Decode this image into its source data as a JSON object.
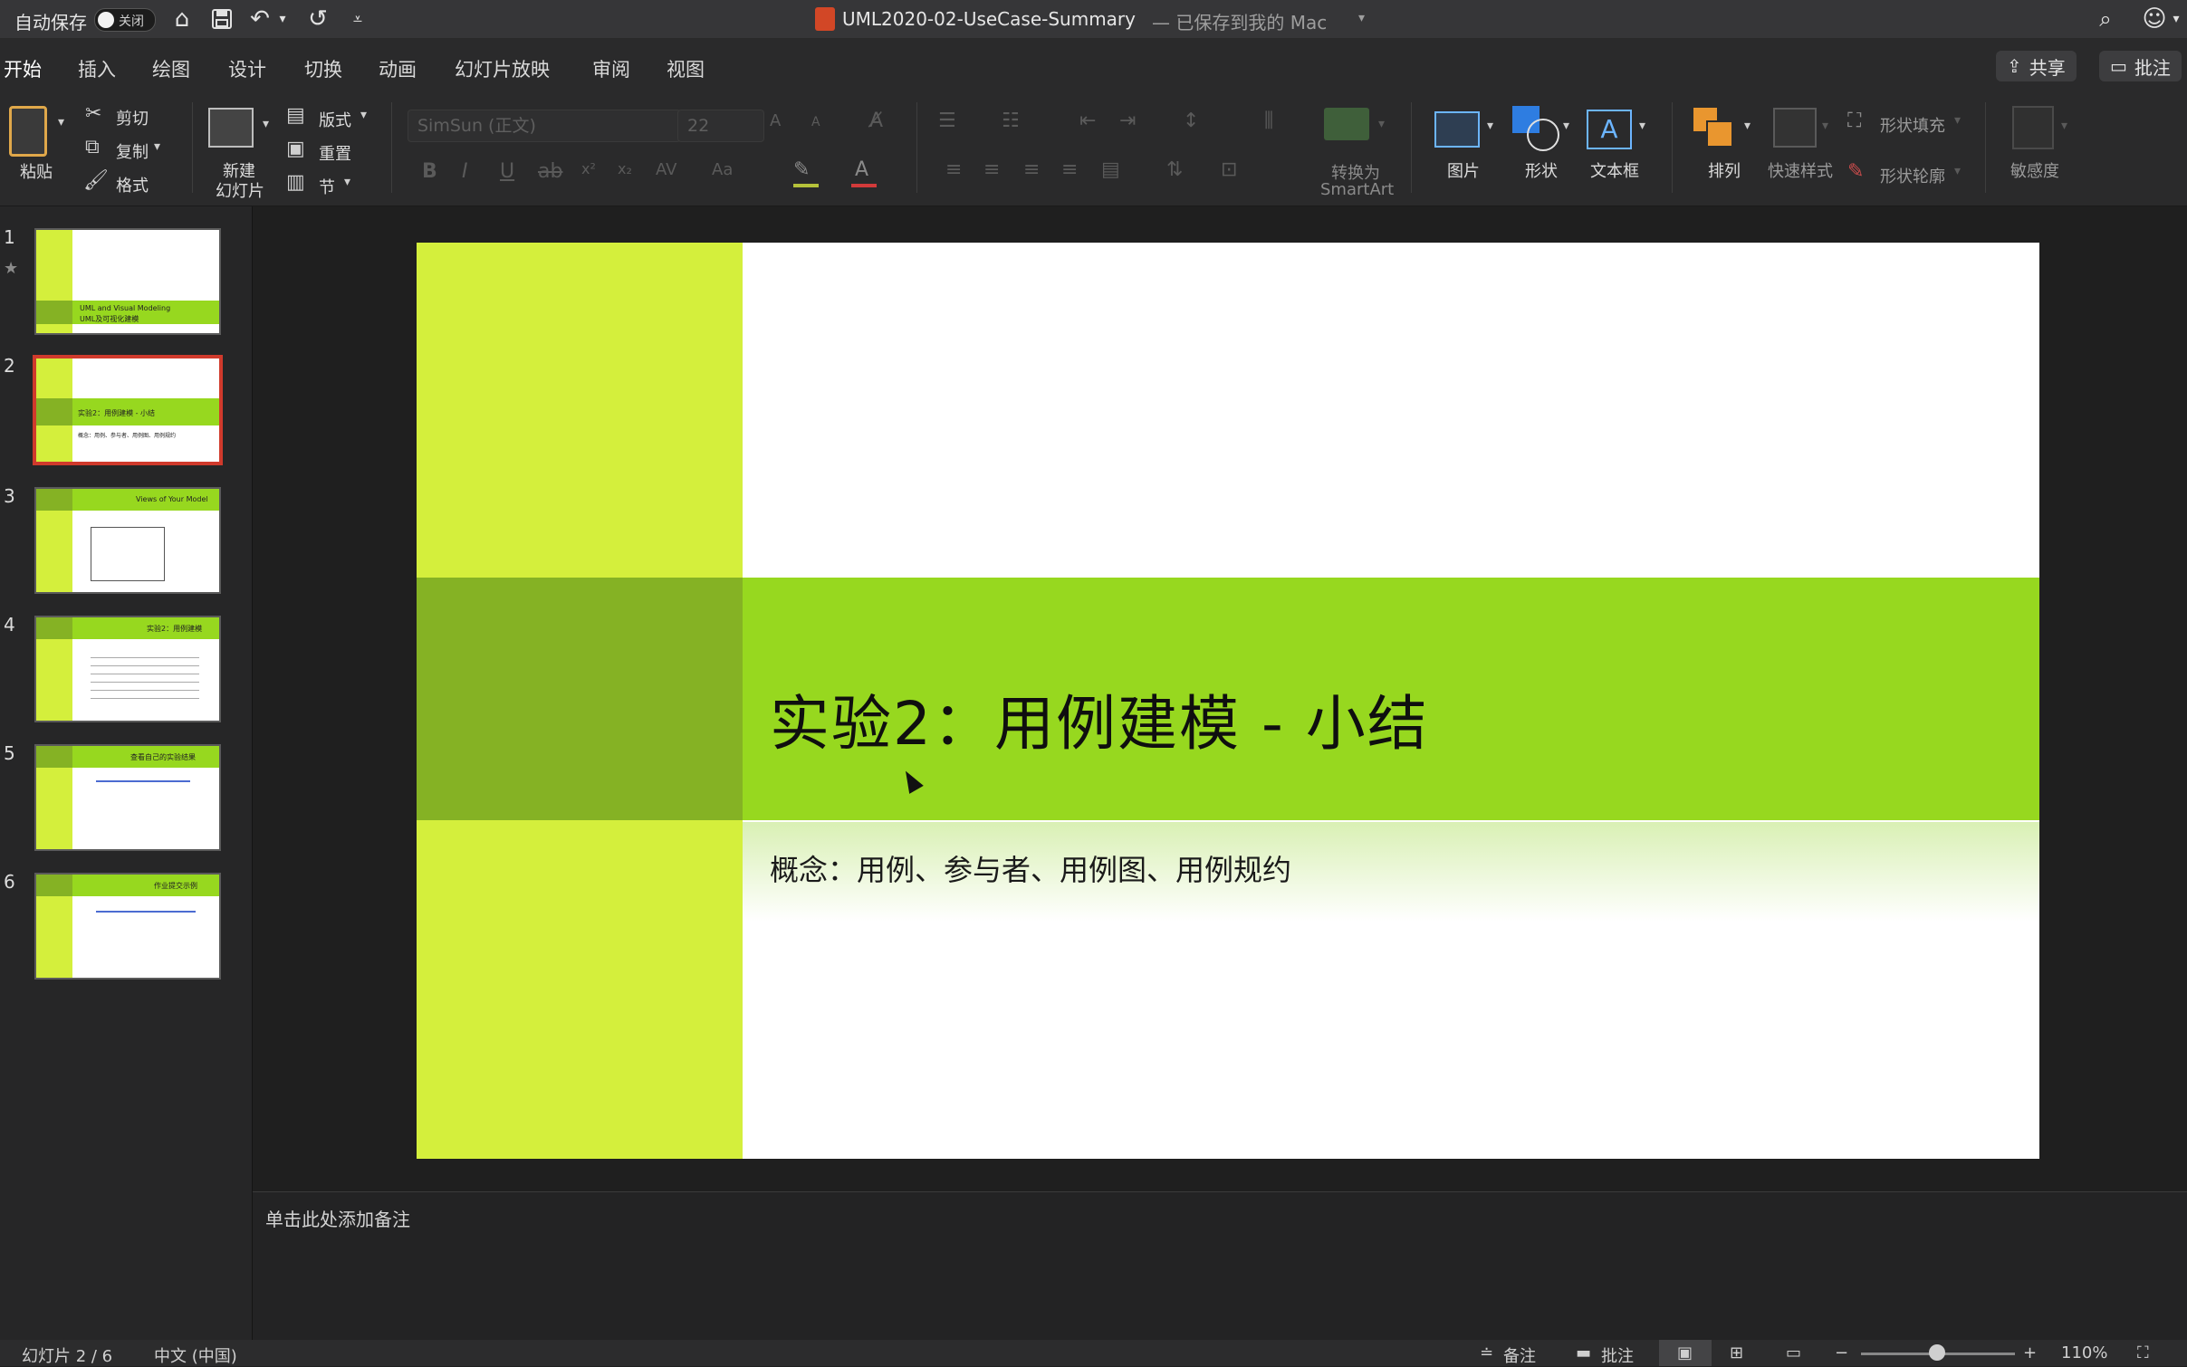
{
  "titlebar": {
    "autosave_label": "自动保存",
    "autosave_state": "关闭",
    "doc_title": "UML2020-02-UseCase-Summary",
    "save_status": "— 已保存到我的 Mac"
  },
  "tabs": [
    "开始",
    "插入",
    "绘图",
    "设计",
    "切换",
    "动画",
    "幻灯片放映",
    "审阅",
    "视图"
  ],
  "share_label": "共享",
  "comments_label": "批注",
  "ribbon": {
    "paste": "粘贴",
    "cut": "剪切",
    "copy": "复制",
    "format": "格式",
    "new_slide_line1": "新建",
    "new_slide_line2": "幻灯片",
    "layout": "版式",
    "reset": "重置",
    "section": "节",
    "font_name": "SimSun (正文)",
    "font_size": "22",
    "convert_line1": "转换为",
    "convert_line2": "SmartArt",
    "picture": "图片",
    "shape": "形状",
    "textbox": "文本框",
    "arrange": "排列",
    "quick_styles": "快速样式",
    "shape_fill": "形状填充",
    "shape_outline": "形状轮廓",
    "sensitivity": "敏感度"
  },
  "slides": [
    {
      "num": "1",
      "starred": true,
      "line1": "UML and Visual Modeling",
      "line2": "UML及可视化建模"
    },
    {
      "num": "2",
      "title": "实验2：用例建模 - 小结",
      "sub": "概念：用例、参与者、用例图、用例规约"
    },
    {
      "num": "3",
      "title": "Views of Your Model"
    },
    {
      "num": "4",
      "title": "实验2：用例建模"
    },
    {
      "num": "5",
      "title": "查看自己的实验结果"
    },
    {
      "num": "6",
      "title": "作业提交示例"
    }
  ],
  "current_slide": {
    "title": "实验2：用例建模 - 小结",
    "subtitle": "概念：用例、参与者、用例图、用例规约"
  },
  "notes_placeholder": "单击此处添加备注",
  "status": {
    "slide_pos": "幻灯片 2 / 6",
    "language": "中文 (中国)",
    "notes": "备注",
    "comments": "批注",
    "zoom": "110%"
  },
  "colors": {
    "accent_lime": "#d4ef3c",
    "accent_green": "#97d81f",
    "accent_dark_green": "#85b224",
    "selection_red": "#d03a2c"
  }
}
